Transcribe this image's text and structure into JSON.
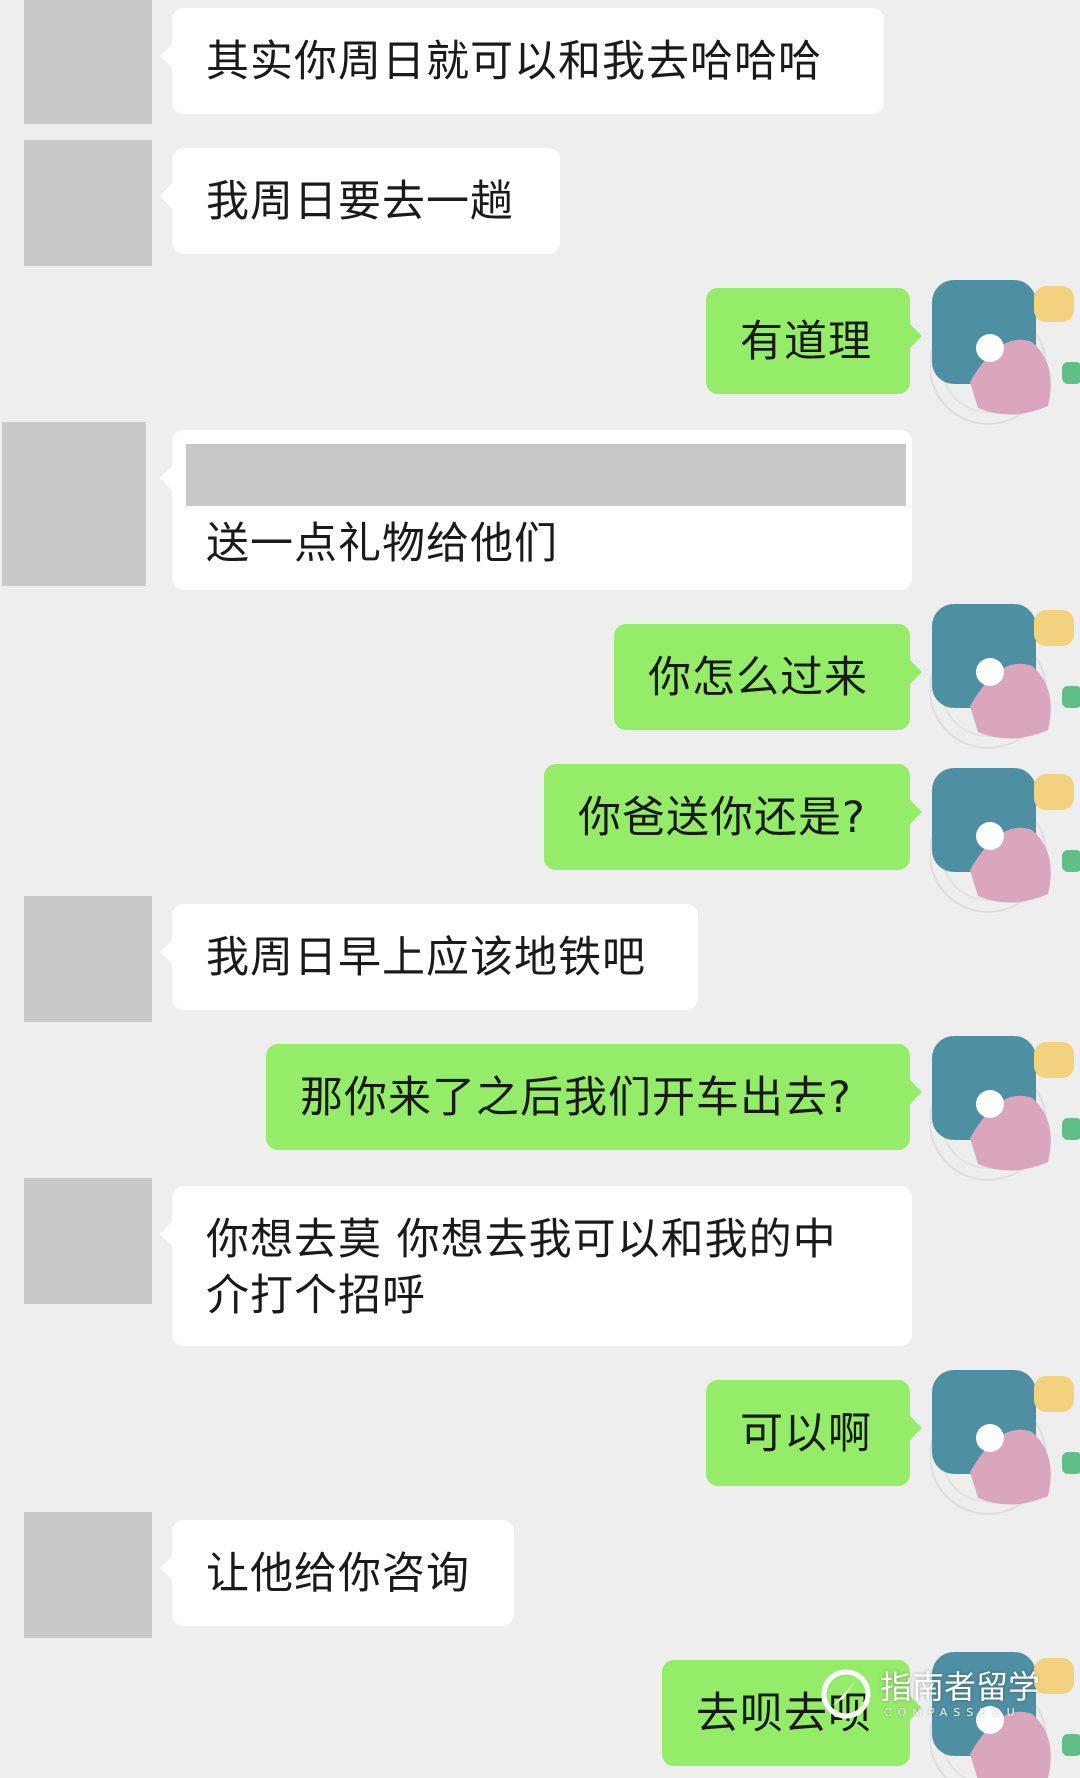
{
  "colors": {
    "background": "#eeeeee",
    "incoming_bubble": "#ffffff",
    "outgoing_bubble": "#95ec69",
    "avatar_placeholder": "#c9c9c9",
    "avatar_teal": "#4f8fa3",
    "avatar_pink": "#d9a6bd",
    "avatar_yellow": "#f3d27f",
    "avatar_green": "#5fbf86"
  },
  "messages": [
    {
      "side": "in",
      "text": "其实你周日就可以和我去哈哈哈"
    },
    {
      "side": "in",
      "text": "我周日要去一趟"
    },
    {
      "side": "out",
      "text": "有道理"
    },
    {
      "side": "in",
      "text": "送一点礼物给他们",
      "redacted_line": true
    },
    {
      "side": "out",
      "text": "你怎么过来"
    },
    {
      "side": "out",
      "text": "你爸送你还是?"
    },
    {
      "side": "in",
      "text": "我周日早上应该地铁吧"
    },
    {
      "side": "out",
      "text": "那你来了之后我们开车出去?"
    },
    {
      "side": "in",
      "text": "你想去莫 你想去我可以和我的中介打个招呼"
    },
    {
      "side": "out",
      "text": "可以啊"
    },
    {
      "side": "in",
      "text": "让他给你咨询"
    },
    {
      "side": "out",
      "text": "去呗去呗"
    }
  ],
  "watermark": {
    "text": "指南者留学",
    "subtext": "COMPASSEDU"
  }
}
